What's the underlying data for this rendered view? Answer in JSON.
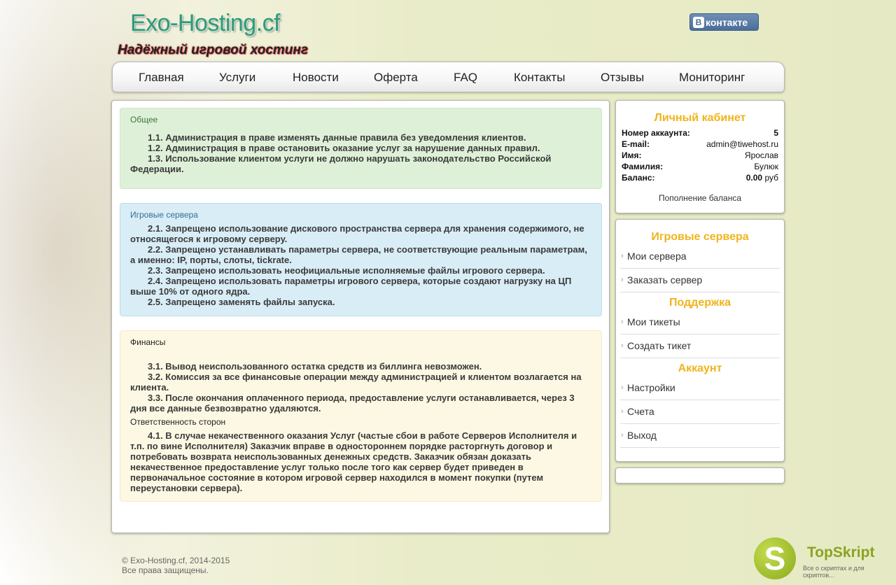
{
  "header": {
    "logo": "Exo-Hosting.cf",
    "tagline": "Надёжный игровой хостинг",
    "vk_badge": "B",
    "vk_label": "контакте"
  },
  "nav": [
    "Главная",
    "Услуги",
    "Новости",
    "Оферта",
    "FAQ",
    "Контакты",
    "Отзывы",
    "Мониторинг"
  ],
  "sections": {
    "general": {
      "title": "Общее",
      "rules": [
        "1.1. Администрация в праве изменять данные правила без уведомления клиентов.",
        "1.2. Администрация в праве остановить оказание услуг за нарушение данных правил.",
        "1.3. Использование клиентом услуги не должно нарушать законодательство Российской Федерации."
      ]
    },
    "servers": {
      "title": "Игровые сервера",
      "rules": [
        "2.1. Запрещено использование дискового пространства сервера для хранения содержимого, не относящегося к игровому серверу.",
        "2.2. Запрещено устанавливать параметры сервера, не соответствующие реальным параметрам, а именно: IP, порты, слоты, tickrate.",
        "2.3. Запрещено использовать неофициальные исполняемые файлы игрового сервера.",
        "2.4. Запрещено использовать параметры игрового сервера, которые создают нагрузку на ЦП выше 10% от одного ядра.",
        "2.5. Запрещено заменять файлы запуска."
      ]
    },
    "finance": {
      "title": "Финансы",
      "rules": [
        "3.1. Вывод неиспользованного остатка средств из биллинга невозможен.",
        "3.2. Комиссия за все финансовые операции между администрацией и клиентом возлагается на клиента.",
        "3.3. После окончания оплаченного периода, предоставление услуги останавливается, через 3 дня все данные безвозвратно удаляются."
      ]
    },
    "responsibility": {
      "title": "Ответственность сторон",
      "rules": [
        "4.1. В случае некачественного оказания Услуг (частые сбои в работе Серверов Исполнителя и т.п. по вине Исполнителя) Заказчик вправе в одностороннем порядке расторгнуть договор и потребовать возврата неиспользованных денежных средств. Заказчик обязан доказать некачественное предоставление услуг только после того как сервер будет приведен в первоначальное состояние в котором игровой сервер находился в момент покупки (путем переустановки сервера)."
      ]
    }
  },
  "account": {
    "title": "Личный кабинет",
    "rows": [
      {
        "label": "Номер аккаунта:",
        "value": "5"
      },
      {
        "label": "E-mail:",
        "value": "admin@tiwehost.ru"
      },
      {
        "label": "Имя:",
        "value": "Ярослав"
      },
      {
        "label": "Фамилия:",
        "value": "Булюк"
      }
    ],
    "balance_label": "Баланс:",
    "balance_value": "0.00",
    "balance_currency": "руб",
    "topup": "Пополнение баланса"
  },
  "sidebar": {
    "servers_title": "Игровые сервера",
    "servers_items": [
      "Мои сервера",
      "Заказать сервер"
    ],
    "support_title": "Поддержка",
    "support_items": [
      "Мои тикеты",
      "Создать тикет"
    ],
    "account_title": "Аккаунт",
    "account_items": [
      "Настройки",
      "Счета",
      "Выход"
    ]
  },
  "footer": {
    "copyright": "© Exo-Hosting.cf, 2014-2015",
    "rights": "Все права защищены."
  },
  "watermark": {
    "badge": "S",
    "name": "TopSkript",
    "subtitle": "Все о скриптах и для скриптов..."
  }
}
